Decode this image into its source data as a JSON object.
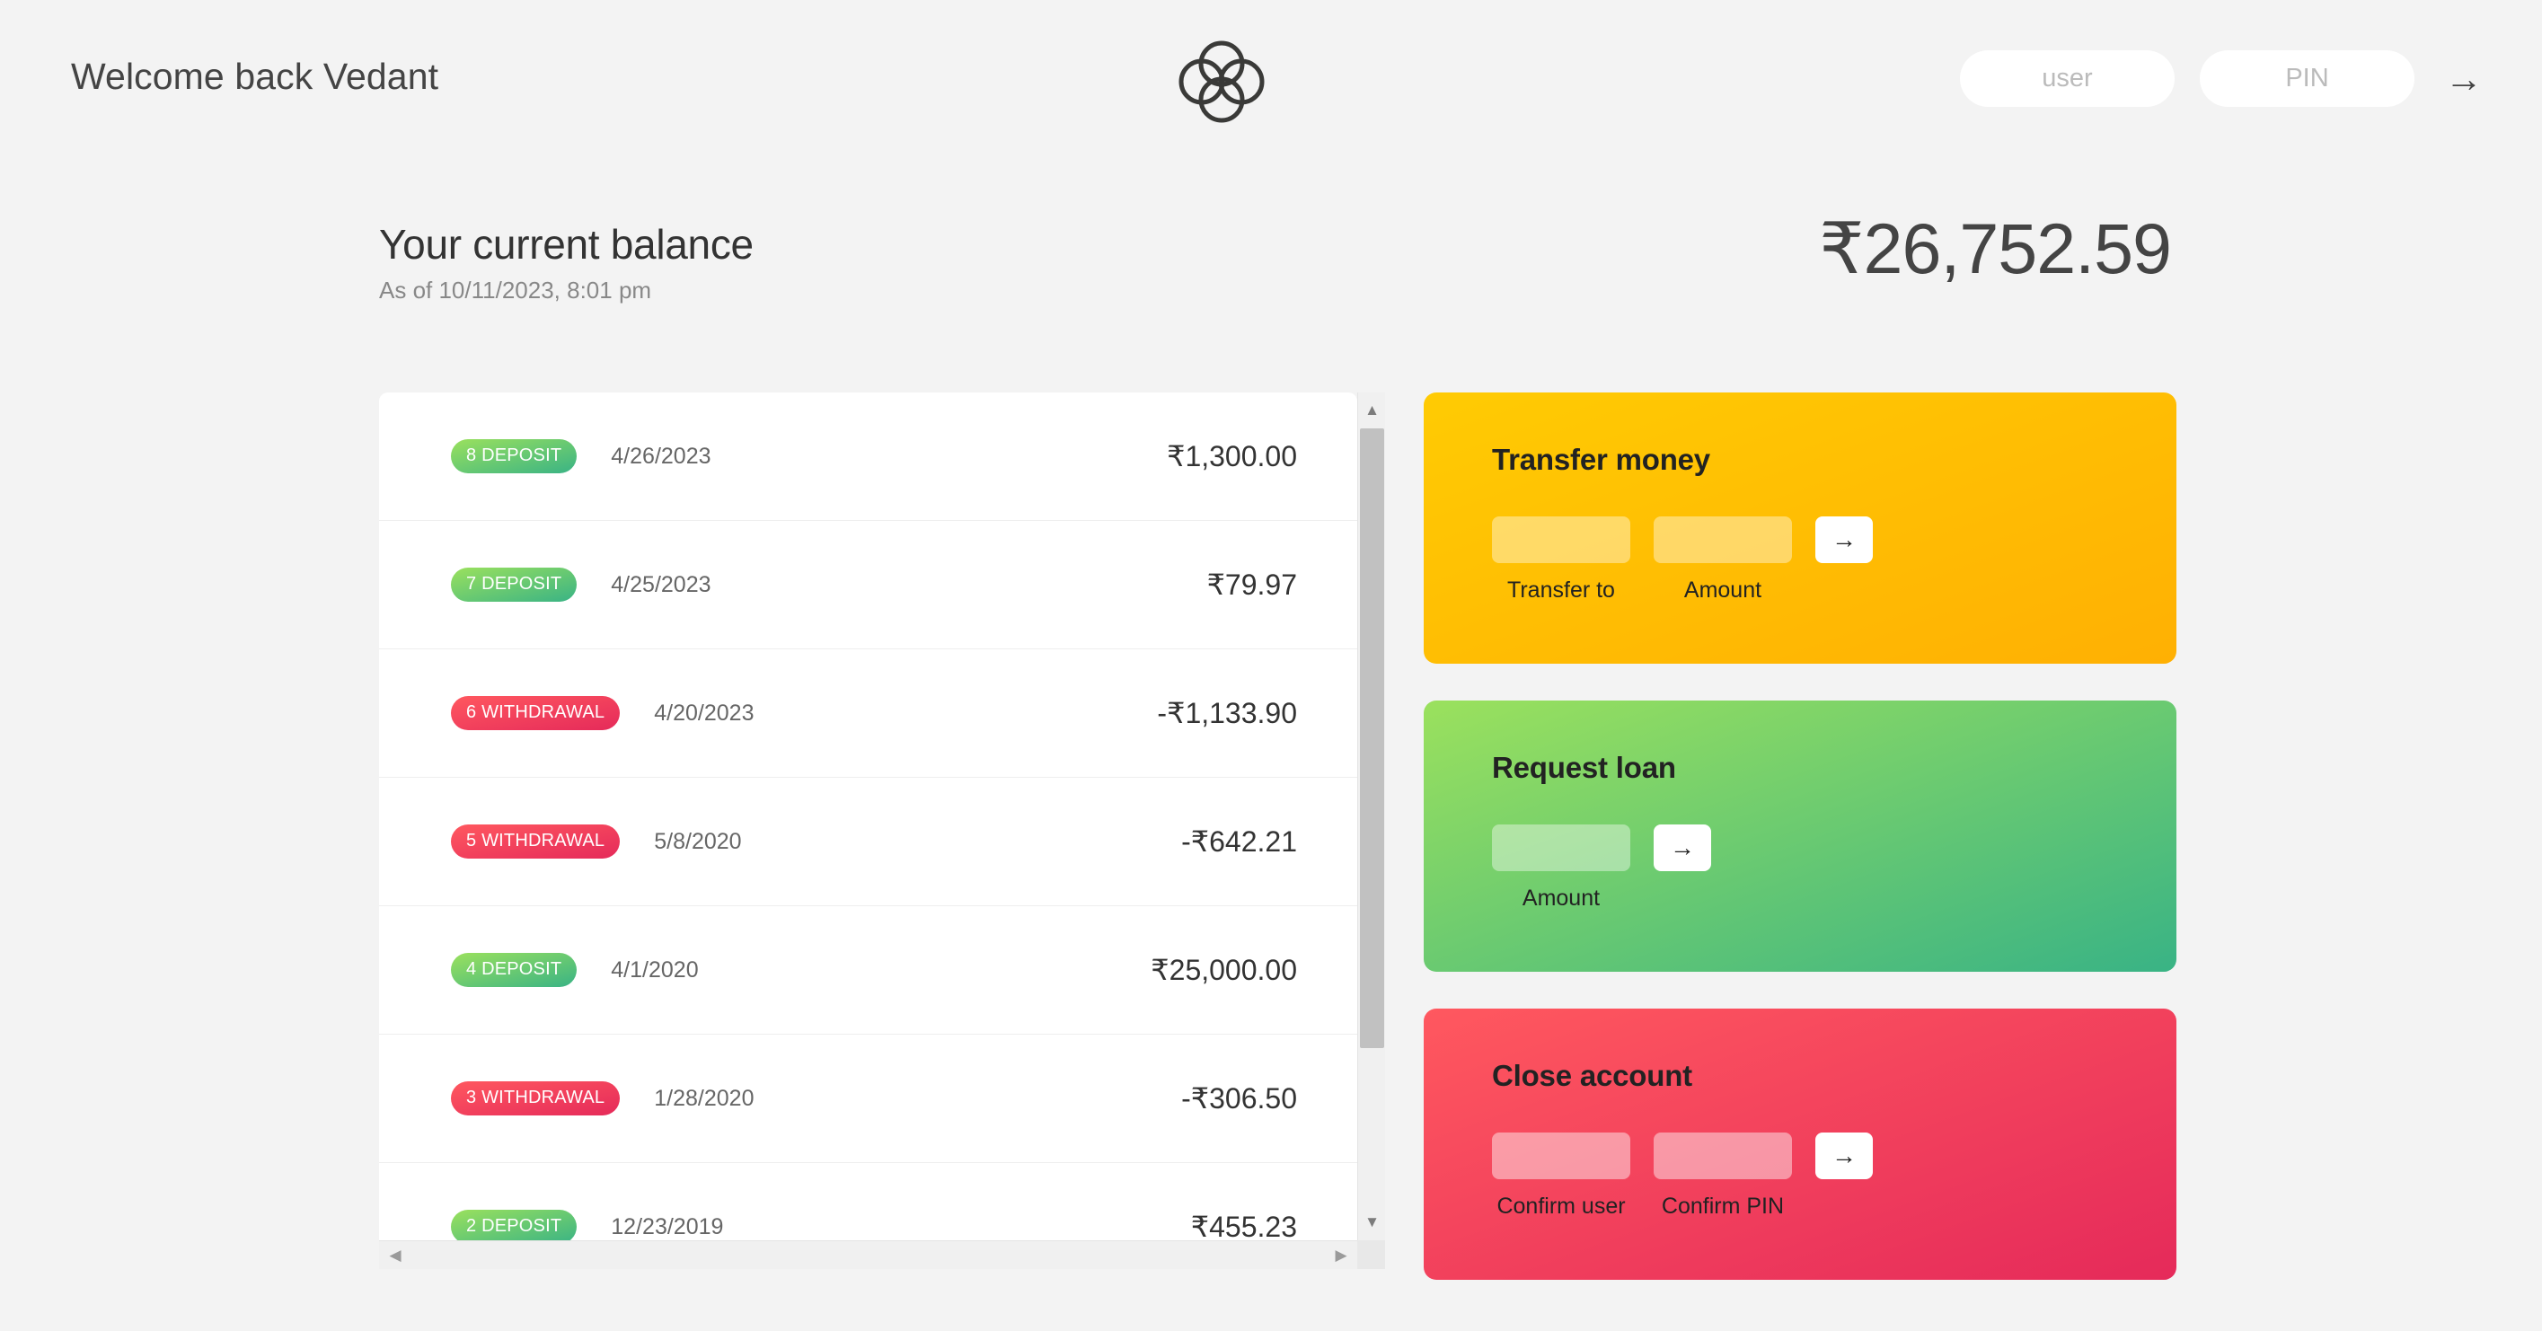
{
  "header": {
    "welcome": "Welcome back Vedant",
    "logo_icon": "four-circles-logo",
    "login": {
      "user_placeholder": "user",
      "user_value": "",
      "pin_placeholder": "PIN",
      "pin_value": "",
      "submit_icon": "arrow-right-icon",
      "submit_label": "→"
    }
  },
  "balance": {
    "title": "Your current balance",
    "date": "As of 10/11/2023, 8:01 pm",
    "value": "₹26,752.59"
  },
  "movements": [
    {
      "index": "8",
      "type": "DEPOSIT",
      "kind": "deposit",
      "badge": "8 DEPOSIT",
      "date": "4/26/2023",
      "value": "₹1,300.00"
    },
    {
      "index": "7",
      "type": "DEPOSIT",
      "kind": "deposit",
      "badge": "7 DEPOSIT",
      "date": "4/25/2023",
      "value": "₹79.97"
    },
    {
      "index": "6",
      "type": "WITHDRAWAL",
      "kind": "withdrawal",
      "badge": "6 WITHDRAWAL",
      "date": "4/20/2023",
      "value": "-₹1,133.90"
    },
    {
      "index": "5",
      "type": "WITHDRAWAL",
      "kind": "withdrawal",
      "badge": "5 WITHDRAWAL",
      "date": "5/8/2020",
      "value": "-₹642.21"
    },
    {
      "index": "4",
      "type": "DEPOSIT",
      "kind": "deposit",
      "badge": "4 DEPOSIT",
      "date": "4/1/2020",
      "value": "₹25,000.00"
    },
    {
      "index": "3",
      "type": "WITHDRAWAL",
      "kind": "withdrawal",
      "badge": "3 WITHDRAWAL",
      "date": "1/28/2020",
      "value": "-₹306.50"
    },
    {
      "index": "2",
      "type": "DEPOSIT",
      "kind": "deposit",
      "badge": "2 DEPOSIT",
      "date": "12/23/2019",
      "value": "₹455.23"
    }
  ],
  "operations": {
    "transfer": {
      "title": "Transfer money",
      "to_label": "Transfer to",
      "to_value": "",
      "amount_label": "Amount",
      "amount_value": "",
      "submit_label": "→"
    },
    "loan": {
      "title": "Request loan",
      "amount_label": "Amount",
      "amount_value": "",
      "submit_label": "→"
    },
    "close": {
      "title": "Close account",
      "user_label": "Confirm user",
      "user_value": "",
      "pin_label": "Confirm PIN",
      "pin_value": "",
      "submit_label": "→"
    }
  },
  "scrollbars": {
    "up_arrow": "▲",
    "down_arrow": "▼",
    "left_arrow": "◀",
    "right_arrow": "▶"
  },
  "colors": {
    "page_bg": "#f3f3f3",
    "deposit_from": "#9be15d",
    "deposit_to": "#39b385",
    "withdrawal_from": "#ff585f",
    "withdrawal_to": "#e52a5a",
    "transfer_from": "#ffcb03",
    "transfer_to": "#ffb003",
    "text_dark": "#444444"
  }
}
